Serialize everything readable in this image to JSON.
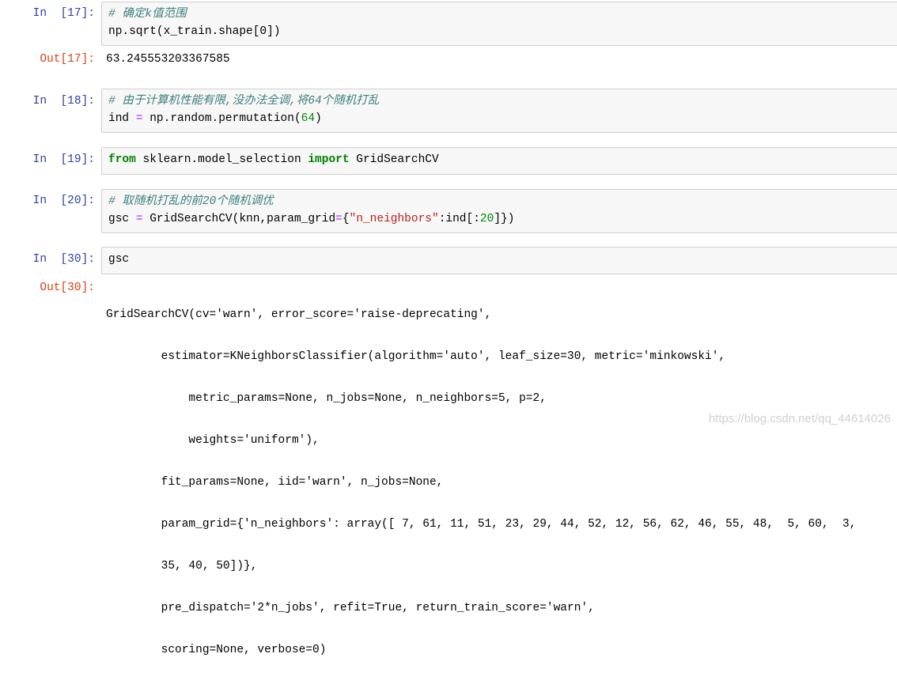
{
  "cells": {
    "c17": {
      "prompt": "In  [17]:",
      "comment": "# 确定k值范围",
      "code": "np.sqrt(x_train.shape[0])",
      "out_prompt": "Out[17]:",
      "output": "63.245553203367585"
    },
    "c18": {
      "prompt": "In  [18]:",
      "comment": "# 由于计算机性能有限,没办法全调,将64个随机打乱",
      "code_a": "ind ",
      "code_eq": "=",
      "code_b": " np.random.permutation(",
      "code_num": "64",
      "code_c": ")"
    },
    "c19": {
      "prompt": "In  [19]:",
      "kw_from": "from",
      "code_a": " sklearn.model_selection ",
      "kw_import": "import",
      "code_b": " GridSearchCV"
    },
    "c20": {
      "prompt": "In  [20]:",
      "comment": "# 取随机打乱的前20个随机调优",
      "code_a": "gsc ",
      "code_eq": "=",
      "code_b": " GridSearchCV(knn,param_grid",
      "code_eq2": "=",
      "code_c": "{",
      "code_str": "\"n_neighbors\"",
      "code_d": ":ind[:",
      "code_num": "20",
      "code_e": "]})"
    },
    "c30": {
      "prompt": "In  [30]:",
      "code": "gsc",
      "out_prompt": "Out[30]:",
      "output_lines": [
        "GridSearchCV(cv='warn', error_score='raise-deprecating',",
        "        estimator=KNeighborsClassifier(algorithm='auto', leaf_size=30, metric='minkowski',",
        "            metric_params=None, n_jobs=None, n_neighbors=5, p=2,",
        "            weights='uniform'),",
        "        fit_params=None, iid='warn', n_jobs=None,",
        "        param_grid={'n_neighbors': array([ 7, 61, 11, 51, 23, 29, 44, 52, 12, 56, 62, 46, 55, 48,  5, 60,  3,",
        "        35, 40, 50])},",
        "        pre_dispatch='2*n_jobs', refit=True, return_train_score='warn',",
        "        scoring=None, verbose=0)"
      ]
    }
  },
  "watermark": "https://blog.csdn.net/qq_44614026"
}
